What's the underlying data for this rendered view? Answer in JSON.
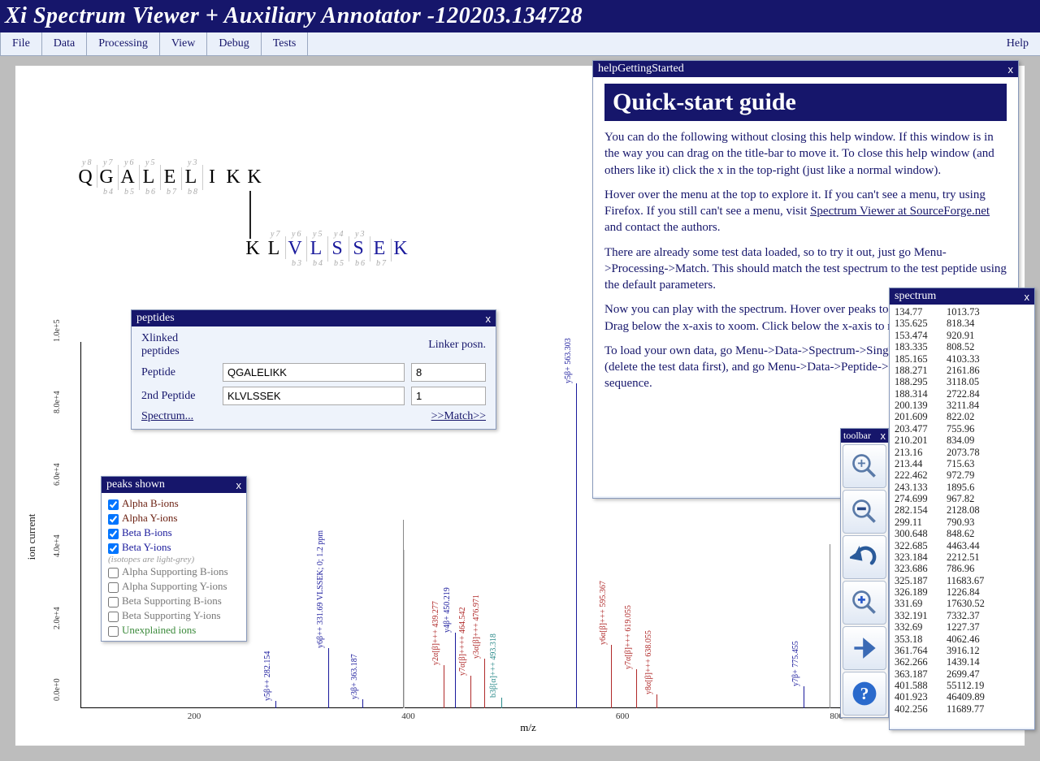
{
  "app_title": "Xi Spectrum Viewer + Auxiliary Annotator -120203.134728",
  "menu": {
    "file": "File",
    "data": "Data",
    "processing": "Processing",
    "view": "View",
    "debug": "Debug",
    "tests": "Tests",
    "help": "Help"
  },
  "sequence": {
    "peptide1": [
      "Q",
      "G",
      "A",
      "L",
      "E",
      "L",
      "I",
      "K",
      "K"
    ],
    "peptide1_top_frags": [
      "y8",
      "y7",
      "y6",
      "y5",
      "",
      "y3",
      "",
      "",
      ""
    ],
    "peptide1_bot_frags": [
      "",
      "b4",
      "b5",
      "b6",
      "b7",
      "b8",
      "",
      "",
      ""
    ],
    "peptide2": [
      "K",
      "L",
      "V",
      "L",
      "S",
      "S",
      "E",
      "K"
    ],
    "peptide2_blue_from": 2,
    "peptide2_top_frags": [
      "",
      "y7",
      "y6",
      "y5",
      "y4",
      "y3",
      "",
      ""
    ],
    "peptide2_bot_frags": [
      "",
      "",
      "b3",
      "b4",
      "b5",
      "b6",
      "b7",
      ""
    ]
  },
  "peptides_panel": {
    "title": "peptides",
    "header": "Xlinked peptides",
    "linker_col": "Linker posn.",
    "row1_label": "Peptide",
    "row1_value": "QGALELIKK",
    "row1_linker": "8",
    "row2_label": "2nd Peptide",
    "row2_value": "KLVLSSEK",
    "row2_linker": "1",
    "spectrum_link": "Spectrum...",
    "match_link": ">>Match>>"
  },
  "peaks_panel": {
    "title": "peaks shown",
    "items": [
      {
        "label": "Alpha B-ions",
        "checked": true,
        "cls": "clr-darkred"
      },
      {
        "label": "Alpha Y-ions",
        "checked": true,
        "cls": "clr-darkred"
      },
      {
        "label": "Beta B-ions",
        "checked": true,
        "cls": "clr-blue"
      },
      {
        "label": "Beta Y-ions",
        "checked": true,
        "cls": "clr-blue"
      }
    ],
    "note": "(isotopes are light-grey)",
    "items2": [
      {
        "label": "Alpha Supporting B-ions",
        "checked": false,
        "cls": "clr-gray"
      },
      {
        "label": "Alpha Supporting Y-ions",
        "checked": false,
        "cls": "clr-gray"
      },
      {
        "label": "Beta Supporting B-ions",
        "checked": false,
        "cls": "clr-gray"
      },
      {
        "label": "Beta Supporting Y-ions",
        "checked": false,
        "cls": "clr-gray"
      },
      {
        "label": "Unexplained ions",
        "checked": false,
        "cls": "clr-green"
      }
    ]
  },
  "help_panel": {
    "title": "helpGettingStarted",
    "heading": "Quick-start guide",
    "p1": "You can do the following without closing this help window. If this window is in the way you can drag on the title-bar to move it. To close this help window (and others like it) click the x in the top-right (just like a normal window).",
    "p2a": "Hover over the menu at the top to explore it. If you can't see a menu, try using Firefox. If you still can't see a menu, visit ",
    "p2_link": "Spectrum Viewer at SourceForge.net",
    "p2b": " and contact the authors.",
    "p3": "There are already some test data loaded, so to try it out, just go Menu->Processing->Match. This should match the test spectrum to the test peptide using the default parameters.",
    "p4": "Now you can play with the spectrum. Hover over peaks to see what happens. Drag below the x-axis to xoom. Click below the x-axis to measure.",
    "p5": "To load your own data, go Menu->Data->Spectrum->Single, add your spectrum (delete the test data first), and go Menu->Data->Peptide->Single and input your sequence."
  },
  "toolbar_panel": {
    "title": "toolbar"
  },
  "spectrum_panel": {
    "title": "spectrum",
    "rows": [
      [
        "134.77",
        "1013.73"
      ],
      [
        "135.625",
        "818.34"
      ],
      [
        "153.474",
        "920.91"
      ],
      [
        "183.335",
        "808.52"
      ],
      [
        "185.165",
        "4103.33"
      ],
      [
        "188.271",
        "2161.86"
      ],
      [
        "188.295",
        "3118.05"
      ],
      [
        "188.314",
        "2722.84"
      ],
      [
        "200.139",
        "3211.84"
      ],
      [
        "201.609",
        "822.02"
      ],
      [
        "203.477",
        "755.96"
      ],
      [
        "210.201",
        "834.09"
      ],
      [
        "213.16",
        "2073.78"
      ],
      [
        "213.44",
        "715.63"
      ],
      [
        "222.462",
        "972.79"
      ],
      [
        "243.133",
        "1895.6"
      ],
      [
        "274.699",
        "967.82"
      ],
      [
        "282.154",
        "2128.08"
      ],
      [
        "299.11",
        "790.93"
      ],
      [
        "300.648",
        "848.62"
      ],
      [
        "322.685",
        "4463.44"
      ],
      [
        "323.184",
        "2212.51"
      ],
      [
        "323.686",
        "786.96"
      ],
      [
        "325.187",
        "11683.67"
      ],
      [
        "326.189",
        "1226.84"
      ],
      [
        "331.69",
        "17630.52"
      ],
      [
        "332.191",
        "7332.37"
      ],
      [
        "332.69",
        "1227.37"
      ],
      [
        "353.18",
        "4062.46"
      ],
      [
        "361.764",
        "3916.12"
      ],
      [
        "362.266",
        "1439.14"
      ],
      [
        "363.187",
        "2699.47"
      ],
      [
        "401.588",
        "55112.19"
      ],
      [
        "401.923",
        "46409.89"
      ],
      [
        "402.256",
        "11689.77"
      ]
    ]
  },
  "chart_data": {
    "type": "bar",
    "title": "",
    "xlabel": "m/z",
    "ylabel": "ion current",
    "xlim": [
      100,
      950
    ],
    "ylim": [
      0,
      105000
    ],
    "yticks": [
      "0.0e+0",
      "2.0e+4",
      "4.0e+4",
      "6.0e+4",
      "8.0e+4",
      "1.0e+5"
    ],
    "xticks": [
      200,
      400,
      600,
      800
    ],
    "peaks": [
      {
        "mz": 282.154,
        "intensity": 2128,
        "label": "y5β++ 282.154",
        "color": "#1a1a9c"
      },
      {
        "mz": 331.69,
        "intensity": 17630,
        "label": "y6β++ 331.69\nVLSSEK; 0; 1.2 ppm",
        "color": "#1a1a9c"
      },
      {
        "mz": 363.187,
        "intensity": 2699,
        "label": "y3β+ 363.187",
        "color": "#1a1a9c"
      },
      {
        "mz": 401.588,
        "intensity": 55112,
        "label": "",
        "color": "#888"
      },
      {
        "mz": 401.923,
        "intensity": 46409,
        "label": "",
        "color": "#ccc"
      },
      {
        "mz": 439.277,
        "intensity": 12500,
        "label": "y2α[β]+++ 439.277",
        "color": "#b02a2a"
      },
      {
        "mz": 450.219,
        "intensity": 22000,
        "label": "y4β+ 450.219",
        "color": "#1a1a9c"
      },
      {
        "mz": 464.542,
        "intensity": 9500,
        "label": "y7α[β]++++ 464.542",
        "color": "#b02a2a"
      },
      {
        "mz": 476.971,
        "intensity": 14500,
        "label": "y3α[β]+++ 476.971",
        "color": "#b02a2a"
      },
      {
        "mz": 493.318,
        "intensity": 3200,
        "label": "b3β[α]+++ 493.318",
        "color": "#2a8a8a"
      },
      {
        "mz": 563.303,
        "intensity": 95000,
        "label": "y5β+ 563.303",
        "color": "#1a1a9c"
      },
      {
        "mz": 595.367,
        "intensity": 18500,
        "label": "y6α[β]+++ 595.367",
        "color": "#b02a2a"
      },
      {
        "mz": 619.055,
        "intensity": 11500,
        "label": "y7α[β]+++ 619.055",
        "color": "#b02a2a"
      },
      {
        "mz": 638.055,
        "intensity": 4000,
        "label": "y8α[β]+++ 638.055",
        "color": "#b02a2a"
      },
      {
        "mz": 775.455,
        "intensity": 6500,
        "label": "y7β+ 775.455",
        "color": "#1a1a9c"
      },
      {
        "mz": 800,
        "intensity": 48000,
        "label": "",
        "color": "#888"
      }
    ]
  }
}
